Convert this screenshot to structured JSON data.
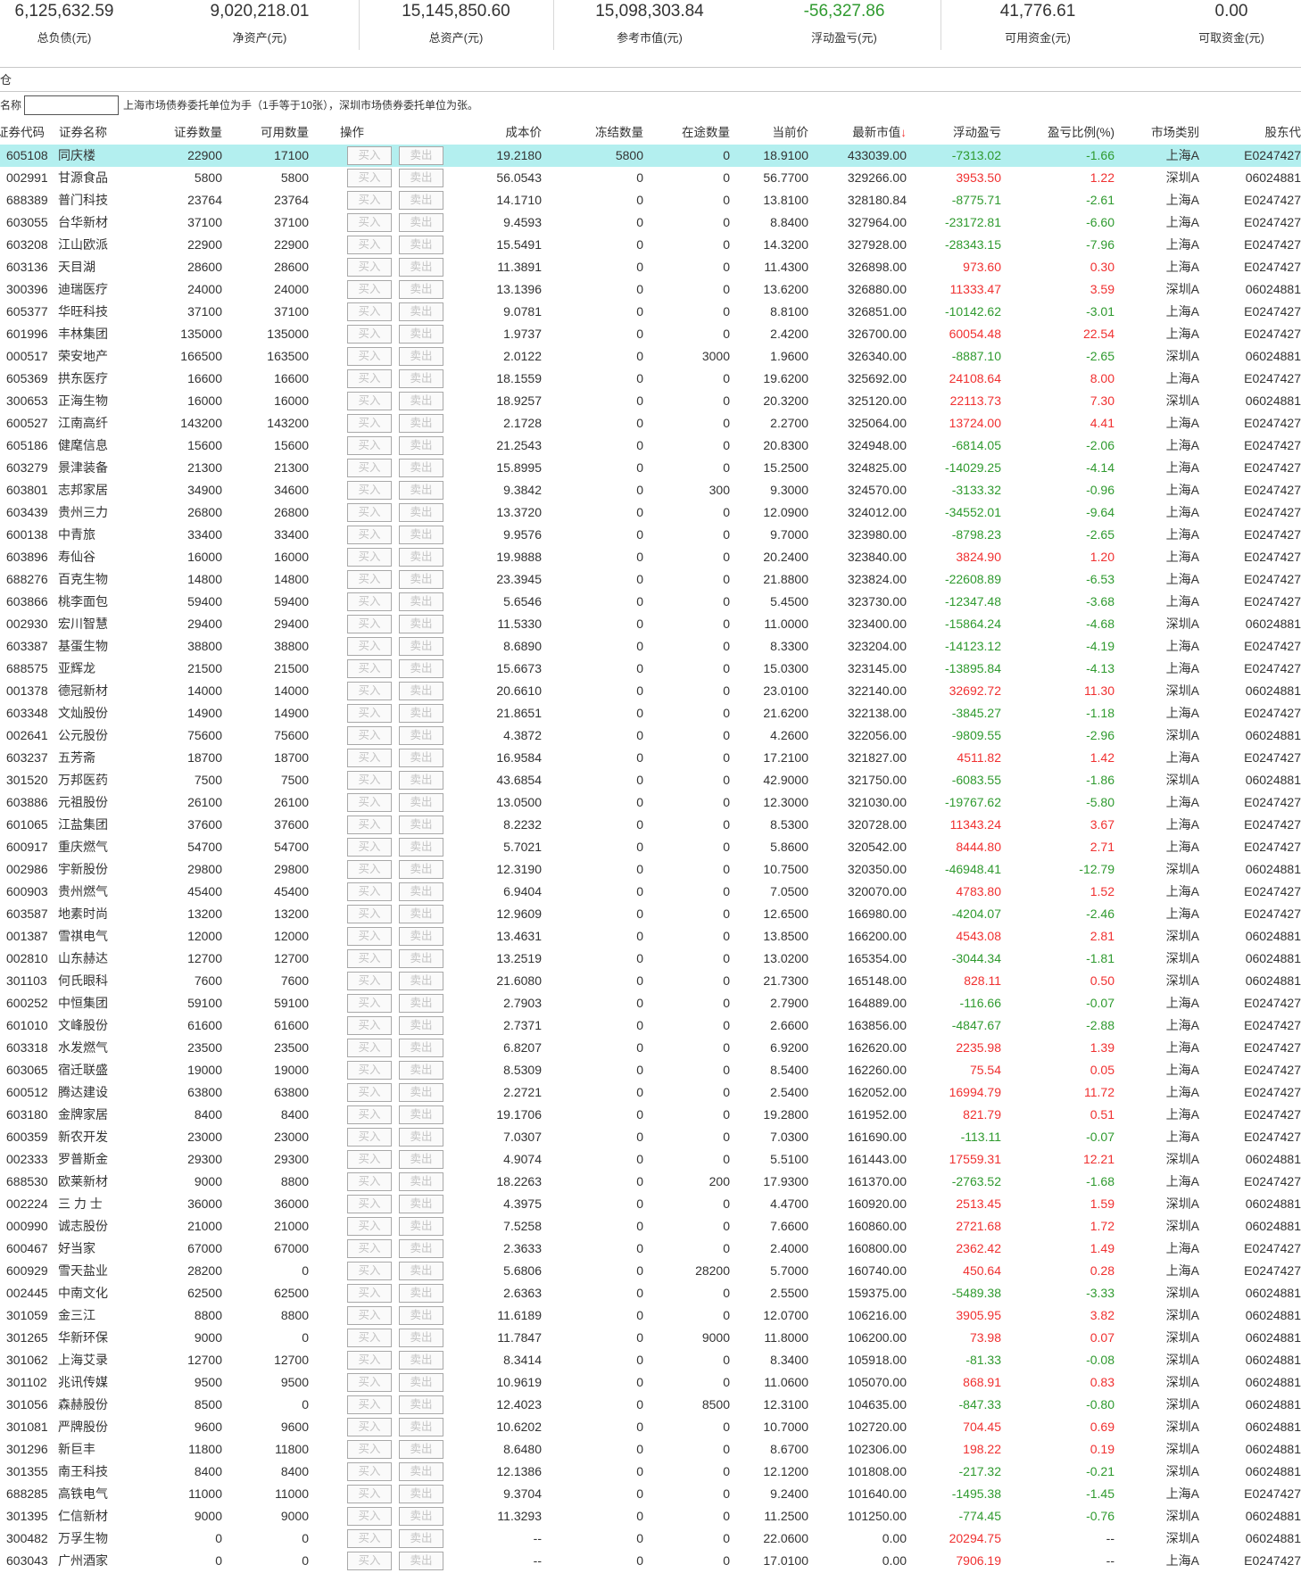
{
  "summary": [
    {
      "value": "6,125,632.59",
      "label": "总负债(元)"
    },
    {
      "value": "9,020,218.01",
      "label": "净资产(元)"
    },
    {
      "value": "15,145,850.60",
      "label": "总资产(元)"
    },
    {
      "value": "15,098,303.84",
      "label": "参考市值(元)"
    },
    {
      "value": "-56,327.86",
      "label": "浮动盈亏(元)"
    },
    {
      "value": "41,776.61",
      "label": "可用资金(元)"
    },
    {
      "value": "0.00",
      "label": "可取资金(元)"
    }
  ],
  "tab_label": "仓",
  "filter": {
    "label": "名称",
    "value": "",
    "note": "上海市场债券委托单位为手（1手等于10张），深圳市场债券委托单位为张。"
  },
  "colors": {
    "positive": "#f03030",
    "negative": "#2f9a2f",
    "selected_row": "#b3efef"
  },
  "table": {
    "sort_icon": "arrow-down-icon",
    "headers": [
      "证券代码",
      "证券名称",
      "证券数量",
      "可用数量",
      "操作",
      "成本价",
      "冻结数量",
      "在途数量",
      "当前价",
      "最新市值",
      "浮动盈亏",
      "盈亏比例(%)",
      "市场类别",
      "股东代"
    ],
    "buy_label": "买入",
    "sell_label": "卖出",
    "selected_index": 0,
    "rows": [
      [
        "605108",
        "同庆楼",
        "22900",
        "17100",
        "19.2180",
        "5800",
        "0",
        "18.9100",
        "433039.00",
        "-7313.02",
        "-1.66",
        "上海A",
        "E0247427"
      ],
      [
        "002991",
        "甘源食品",
        "5800",
        "5800",
        "56.0543",
        "0",
        "0",
        "56.7700",
        "329266.00",
        "3953.50",
        "1.22",
        "深圳A",
        "06024881"
      ],
      [
        "688389",
        "普门科技",
        "23764",
        "23764",
        "14.1710",
        "0",
        "0",
        "13.8100",
        "328180.84",
        "-8775.71",
        "-2.61",
        "上海A",
        "E0247427"
      ],
      [
        "603055",
        "台华新材",
        "37100",
        "37100",
        "9.4593",
        "0",
        "0",
        "8.8400",
        "327964.00",
        "-23172.81",
        "-6.60",
        "上海A",
        "E0247427"
      ],
      [
        "603208",
        "江山欧派",
        "22900",
        "22900",
        "15.5491",
        "0",
        "0",
        "14.3200",
        "327928.00",
        "-28343.15",
        "-7.96",
        "上海A",
        "E0247427"
      ],
      [
        "603136",
        "天目湖",
        "28600",
        "28600",
        "11.3891",
        "0",
        "0",
        "11.4300",
        "326898.00",
        "973.60",
        "0.30",
        "上海A",
        "E0247427"
      ],
      [
        "300396",
        "迪瑞医疗",
        "24000",
        "24000",
        "13.1396",
        "0",
        "0",
        "13.6200",
        "326880.00",
        "11333.47",
        "3.59",
        "深圳A",
        "06024881"
      ],
      [
        "605377",
        "华旺科技",
        "37100",
        "37100",
        "9.0781",
        "0",
        "0",
        "8.8100",
        "326851.00",
        "-10142.62",
        "-3.01",
        "上海A",
        "E0247427"
      ],
      [
        "601996",
        "丰林集团",
        "135000",
        "135000",
        "1.9737",
        "0",
        "0",
        "2.4200",
        "326700.00",
        "60054.48",
        "22.54",
        "上海A",
        "E0247427"
      ],
      [
        "000517",
        "荣安地产",
        "166500",
        "163500",
        "2.0122",
        "0",
        "3000",
        "1.9600",
        "326340.00",
        "-8887.10",
        "-2.65",
        "深圳A",
        "06024881"
      ],
      [
        "605369",
        "拱东医疗",
        "16600",
        "16600",
        "18.1559",
        "0",
        "0",
        "19.6200",
        "325692.00",
        "24108.64",
        "8.00",
        "上海A",
        "E0247427"
      ],
      [
        "300653",
        "正海生物",
        "16000",
        "16000",
        "18.9257",
        "0",
        "0",
        "20.3200",
        "325120.00",
        "22113.73",
        "7.30",
        "深圳A",
        "06024881"
      ],
      [
        "600527",
        "江南高纤",
        "143200",
        "143200",
        "2.1728",
        "0",
        "0",
        "2.2700",
        "325064.00",
        "13724.00",
        "4.41",
        "上海A",
        "E0247427"
      ],
      [
        "605186",
        "健麾信息",
        "15600",
        "15600",
        "21.2543",
        "0",
        "0",
        "20.8300",
        "324948.00",
        "-6814.05",
        "-2.06",
        "上海A",
        "E0247427"
      ],
      [
        "603279",
        "景津装备",
        "21300",
        "21300",
        "15.8995",
        "0",
        "0",
        "15.2500",
        "324825.00",
        "-14029.25",
        "-4.14",
        "上海A",
        "E0247427"
      ],
      [
        "603801",
        "志邦家居",
        "34900",
        "34600",
        "9.3842",
        "0",
        "300",
        "9.3000",
        "324570.00",
        "-3133.32",
        "-0.96",
        "上海A",
        "E0247427"
      ],
      [
        "603439",
        "贵州三力",
        "26800",
        "26800",
        "13.3720",
        "0",
        "0",
        "12.0900",
        "324012.00",
        "-34552.01",
        "-9.64",
        "上海A",
        "E0247427"
      ],
      [
        "600138",
        "中青旅",
        "33400",
        "33400",
        "9.9576",
        "0",
        "0",
        "9.7000",
        "323980.00",
        "-8798.23",
        "-2.65",
        "上海A",
        "E0247427"
      ],
      [
        "603896",
        "寿仙谷",
        "16000",
        "16000",
        "19.9888",
        "0",
        "0",
        "20.2400",
        "323840.00",
        "3824.90",
        "1.20",
        "上海A",
        "E0247427"
      ],
      [
        "688276",
        "百克生物",
        "14800",
        "14800",
        "23.3945",
        "0",
        "0",
        "21.8800",
        "323824.00",
        "-22608.89",
        "-6.53",
        "上海A",
        "E0247427"
      ],
      [
        "603866",
        "桃李面包",
        "59400",
        "59400",
        "5.6546",
        "0",
        "0",
        "5.4500",
        "323730.00",
        "-12347.48",
        "-3.68",
        "上海A",
        "E0247427"
      ],
      [
        "002930",
        "宏川智慧",
        "29400",
        "29400",
        "11.5330",
        "0",
        "0",
        "11.0000",
        "323400.00",
        "-15864.24",
        "-4.68",
        "深圳A",
        "06024881"
      ],
      [
        "603387",
        "基蛋生物",
        "38800",
        "38800",
        "8.6890",
        "0",
        "0",
        "8.3300",
        "323204.00",
        "-14123.12",
        "-4.19",
        "上海A",
        "E0247427"
      ],
      [
        "688575",
        "亚辉龙",
        "21500",
        "21500",
        "15.6673",
        "0",
        "0",
        "15.0300",
        "323145.00",
        "-13895.84",
        "-4.13",
        "上海A",
        "E0247427"
      ],
      [
        "001378",
        "德冠新材",
        "14000",
        "14000",
        "20.6610",
        "0",
        "0",
        "23.0100",
        "322140.00",
        "32692.72",
        "11.30",
        "深圳A",
        "06024881"
      ],
      [
        "603348",
        "文灿股份",
        "14900",
        "14900",
        "21.8651",
        "0",
        "0",
        "21.6200",
        "322138.00",
        "-3845.27",
        "-1.18",
        "上海A",
        "E0247427"
      ],
      [
        "002641",
        "公元股份",
        "75600",
        "75600",
        "4.3872",
        "0",
        "0",
        "4.2600",
        "322056.00",
        "-9809.55",
        "-2.96",
        "深圳A",
        "06024881"
      ],
      [
        "603237",
        "五芳斋",
        "18700",
        "18700",
        "16.9584",
        "0",
        "0",
        "17.2100",
        "321827.00",
        "4511.82",
        "1.42",
        "上海A",
        "E0247427"
      ],
      [
        "301520",
        "万邦医药",
        "7500",
        "7500",
        "43.6854",
        "0",
        "0",
        "42.9000",
        "321750.00",
        "-6083.55",
        "-1.86",
        "深圳A",
        "06024881"
      ],
      [
        "603886",
        "元祖股份",
        "26100",
        "26100",
        "13.0500",
        "0",
        "0",
        "12.3000",
        "321030.00",
        "-19767.62",
        "-5.80",
        "上海A",
        "E0247427"
      ],
      [
        "601065",
        "江盐集团",
        "37600",
        "37600",
        "8.2232",
        "0",
        "0",
        "8.5300",
        "320728.00",
        "11343.24",
        "3.67",
        "上海A",
        "E0247427"
      ],
      [
        "600917",
        "重庆燃气",
        "54700",
        "54700",
        "5.7021",
        "0",
        "0",
        "5.8600",
        "320542.00",
        "8444.80",
        "2.71",
        "上海A",
        "E0247427"
      ],
      [
        "002986",
        "宇新股份",
        "29800",
        "29800",
        "12.3190",
        "0",
        "0",
        "10.7500",
        "320350.00",
        "-46948.41",
        "-12.79",
        "深圳A",
        "06024881"
      ],
      [
        "600903",
        "贵州燃气",
        "45400",
        "45400",
        "6.9404",
        "0",
        "0",
        "7.0500",
        "320070.00",
        "4783.80",
        "1.52",
        "上海A",
        "E0247427"
      ],
      [
        "603587",
        "地素时尚",
        "13200",
        "13200",
        "12.9609",
        "0",
        "0",
        "12.6500",
        "166980.00",
        "-4204.07",
        "-2.46",
        "上海A",
        "E0247427"
      ],
      [
        "001387",
        "雪祺电气",
        "12000",
        "12000",
        "13.4631",
        "0",
        "0",
        "13.8500",
        "166200.00",
        "4543.08",
        "2.81",
        "深圳A",
        "06024881"
      ],
      [
        "002810",
        "山东赫达",
        "12700",
        "12700",
        "13.2519",
        "0",
        "0",
        "13.0200",
        "165354.00",
        "-3044.34",
        "-1.81",
        "深圳A",
        "06024881"
      ],
      [
        "301103",
        "何氏眼科",
        "7600",
        "7600",
        "21.6080",
        "0",
        "0",
        "21.7300",
        "165148.00",
        "828.11",
        "0.50",
        "深圳A",
        "06024881"
      ],
      [
        "600252",
        "中恒集团",
        "59100",
        "59100",
        "2.7903",
        "0",
        "0",
        "2.7900",
        "164889.00",
        "-116.66",
        "-0.07",
        "上海A",
        "E0247427"
      ],
      [
        "601010",
        "文峰股份",
        "61600",
        "61600",
        "2.7371",
        "0",
        "0",
        "2.6600",
        "163856.00",
        "-4847.67",
        "-2.88",
        "上海A",
        "E0247427"
      ],
      [
        "603318",
        "水发燃气",
        "23500",
        "23500",
        "6.8207",
        "0",
        "0",
        "6.9200",
        "162620.00",
        "2235.98",
        "1.39",
        "上海A",
        "E0247427"
      ],
      [
        "603065",
        "宿迁联盛",
        "19000",
        "19000",
        "8.5309",
        "0",
        "0",
        "8.5400",
        "162260.00",
        "75.54",
        "0.05",
        "上海A",
        "E0247427"
      ],
      [
        "600512",
        "腾达建设",
        "63800",
        "63800",
        "2.2721",
        "0",
        "0",
        "2.5400",
        "162052.00",
        "16994.79",
        "11.72",
        "上海A",
        "E0247427"
      ],
      [
        "603180",
        "金牌家居",
        "8400",
        "8400",
        "19.1706",
        "0",
        "0",
        "19.2800",
        "161952.00",
        "821.79",
        "0.51",
        "上海A",
        "E0247427"
      ],
      [
        "600359",
        "新农开发",
        "23000",
        "23000",
        "7.0307",
        "0",
        "0",
        "7.0300",
        "161690.00",
        "-113.11",
        "-0.07",
        "上海A",
        "E0247427"
      ],
      [
        "002333",
        "罗普斯金",
        "29300",
        "29300",
        "4.9074",
        "0",
        "0",
        "5.5100",
        "161443.00",
        "17559.31",
        "12.21",
        "深圳A",
        "06024881"
      ],
      [
        "688530",
        "欧莱新材",
        "9000",
        "8800",
        "18.2263",
        "0",
        "200",
        "17.9300",
        "161370.00",
        "-2763.52",
        "-1.68",
        "上海A",
        "E0247427"
      ],
      [
        "002224",
        "三 力 士",
        "36000",
        "36000",
        "4.3975",
        "0",
        "0",
        "4.4700",
        "160920.00",
        "2513.45",
        "1.59",
        "深圳A",
        "06024881"
      ],
      [
        "000990",
        "诚志股份",
        "21000",
        "21000",
        "7.5258",
        "0",
        "0",
        "7.6600",
        "160860.00",
        "2721.68",
        "1.72",
        "深圳A",
        "06024881"
      ],
      [
        "600467",
        "好当家",
        "67000",
        "67000",
        "2.3633",
        "0",
        "0",
        "2.4000",
        "160800.00",
        "2362.42",
        "1.49",
        "上海A",
        "E0247427"
      ],
      [
        "600929",
        "雪天盐业",
        "28200",
        "0",
        "5.6806",
        "0",
        "28200",
        "5.7000",
        "160740.00",
        "450.64",
        "0.28",
        "上海A",
        "E0247427"
      ],
      [
        "002445",
        "中南文化",
        "62500",
        "62500",
        "2.6363",
        "0",
        "0",
        "2.5500",
        "159375.00",
        "-5489.38",
        "-3.33",
        "深圳A",
        "06024881"
      ],
      [
        "301059",
        "金三江",
        "8800",
        "8800",
        "11.6189",
        "0",
        "0",
        "12.0700",
        "106216.00",
        "3905.95",
        "3.82",
        "深圳A",
        "06024881"
      ],
      [
        "301265",
        "华新环保",
        "9000",
        "0",
        "11.7847",
        "0",
        "9000",
        "11.8000",
        "106200.00",
        "73.98",
        "0.07",
        "深圳A",
        "06024881"
      ],
      [
        "301062",
        "上海艾录",
        "12700",
        "12700",
        "8.3414",
        "0",
        "0",
        "8.3400",
        "105918.00",
        "-81.33",
        "-0.08",
        "深圳A",
        "06024881"
      ],
      [
        "301102",
        "兆讯传媒",
        "9500",
        "9500",
        "10.9619",
        "0",
        "0",
        "11.0600",
        "105070.00",
        "868.91",
        "0.83",
        "深圳A",
        "06024881"
      ],
      [
        "301056",
        "森赫股份",
        "8500",
        "0",
        "12.4023",
        "0",
        "8500",
        "12.3100",
        "104635.00",
        "-847.33",
        "-0.80",
        "深圳A",
        "06024881"
      ],
      [
        "301081",
        "严牌股份",
        "9600",
        "9600",
        "10.6202",
        "0",
        "0",
        "10.7000",
        "102720.00",
        "704.45",
        "0.69",
        "深圳A",
        "06024881"
      ],
      [
        "301296",
        "新巨丰",
        "11800",
        "11800",
        "8.6480",
        "0",
        "0",
        "8.6700",
        "102306.00",
        "198.22",
        "0.19",
        "深圳A",
        "06024881"
      ],
      [
        "301355",
        "南王科技",
        "8400",
        "8400",
        "12.1386",
        "0",
        "0",
        "12.1200",
        "101808.00",
        "-217.32",
        "-0.21",
        "深圳A",
        "06024881"
      ],
      [
        "688285",
        "高铁电气",
        "11000",
        "11000",
        "9.3704",
        "0",
        "0",
        "9.2400",
        "101640.00",
        "-1495.38",
        "-1.45",
        "上海A",
        "E0247427"
      ],
      [
        "301395",
        "仁信新材",
        "9000",
        "9000",
        "11.3293",
        "0",
        "0",
        "11.2500",
        "101250.00",
        "-774.45",
        "-0.76",
        "深圳A",
        "06024881"
      ],
      [
        "300482",
        "万孚生物",
        "0",
        "0",
        "--",
        "0",
        "0",
        "22.0600",
        "0.00",
        "20294.75",
        "--",
        "深圳A",
        "06024881"
      ],
      [
        "603043",
        "广州酒家",
        "0",
        "0",
        "--",
        "0",
        "0",
        "17.0100",
        "0.00",
        "7906.19",
        "--",
        "上海A",
        "E0247427"
      ]
    ]
  }
}
